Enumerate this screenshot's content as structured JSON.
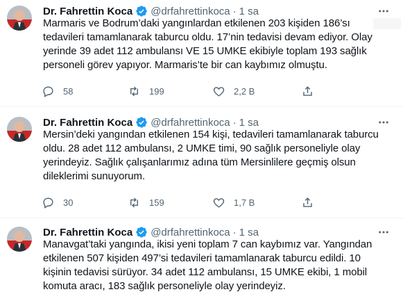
{
  "tweets": [
    {
      "name": "Dr. Fahrettin Koca",
      "handle": "@drfahrettinkoca",
      "dot": "·",
      "time": "1 sa",
      "text": "Marmaris ve Bodrum’daki yangınlardan etkilenen 203 kişiden 186’sı\ntedavileri tamamlanarak taburcu oldu. 17’nin tedavisi devam ediyor. Olay\nyerinde 39 adet 112 ambulansı VE 15 UMKE ekibiyle toplam 193 sağlık\npersoneli görev yapıyor. Marmaris’te bir can kaybımız olmuştu.",
      "replies": "58",
      "retweets": "199",
      "likes": "2,2 B"
    },
    {
      "name": "Dr. Fahrettin Koca",
      "handle": "@drfahrettinkoca",
      "dot": "·",
      "time": "1 sa",
      "text": "Mersin’deki yangından etkilenen 154 kişi, tedavileri tamamlanarak taburcu\noldu. 28 adet 112 ambulansı, 2 UMKE timi, 90 sağlık personeliyle olay\nyerindeyiz. Sağlık çalışanlarımız adına tüm Mersinlilere geçmiş olsun\ndileklerimi sunuyorum.",
      "replies": "30",
      "retweets": "159",
      "likes": "1,7 B"
    },
    {
      "name": "Dr. Fahrettin Koca",
      "handle": "@drfahrettinkoca",
      "dot": "·",
      "time": "1 sa",
      "text": "Manavgat’taki yangında, ikisi yeni toplam 7 can kaybımız var. Yangından\netkilenen 507 kişiden 497’si tedavileri tamamlanarak taburcu edildi. 10\nkişinin tedavisi sürüyor. 34 adet 112 ambulansı, 15 UMKE ekibi, 1 mobil\nkomuta aracı, 183 sağlık personeliyle olay yerindeyiz."
    }
  ],
  "colors": {
    "text": "#0f1419",
    "secondary": "#536471",
    "verified": "#1d9bf0",
    "divider": "#eff3f4"
  },
  "icons": [
    "verified-badge-icon",
    "more-icon",
    "reply-icon",
    "retweet-icon",
    "like-icon",
    "share-icon"
  ]
}
